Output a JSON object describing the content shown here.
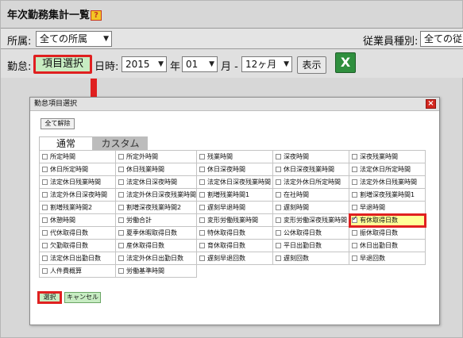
{
  "header": {
    "title": "年次勤務集計一覧",
    "help": "?"
  },
  "row1": {
    "dept_label": "所属:",
    "dept_value": "全ての所属",
    "emp_type_label": "従業員種別:",
    "emp_type_value": "全ての従"
  },
  "row2": {
    "attendance_label": "勤怠:",
    "item_select_button": "項目選択",
    "datetime_label": "日時:",
    "year_value": "2015",
    "year_unit": "年",
    "month_value": "01",
    "month_unit": "月 -",
    "period_value": "12ヶ月",
    "show_button": "表示",
    "excel_icon": "excel-export-icon"
  },
  "dialog": {
    "title": "勤怠項目選択",
    "clear_all": "全て解除",
    "tabs": [
      "通常",
      "カスタム"
    ],
    "rows": [
      [
        "所定時間",
        "所定外時間",
        "残業時間",
        "深夜時間",
        "深夜残業時間"
      ],
      [
        "休日所定時間",
        "休日残業時間",
        "休日深夜時間",
        "休日深夜残業時間",
        "法定休日所定時間"
      ],
      [
        "法定休日残業時間",
        "法定休日深夜時間",
        "法定休日深夜残業時間",
        "法定外休日所定時間",
        "法定外休日残業時間"
      ],
      [
        "法定外休日深夜時間",
        "法定外休日深夜残業時間",
        "割増残業時間1",
        "在社時間",
        "割増深夜残業時間1"
      ],
      [
        "割増残業時間2",
        "割増深夜残業時間2",
        "遅刻早退時間",
        "遅刻時間",
        "早退時間"
      ],
      [
        "休憩時間",
        "労働合計",
        "変形労働残業時間",
        "変形労働深夜残業時間",
        "有休取得日数"
      ],
      [
        "代休取得日数",
        "夏季休暇取得日数",
        "特休取得日数",
        "公休取得日数",
        "振休取得日数"
      ],
      [
        "欠勤取得日数",
        "産休取得日数",
        "育休取得日数",
        "平日出勤日数",
        "休日出勤日数"
      ],
      [
        "法定休日出勤日数",
        "法定外休日出勤日数",
        "遅刻早退回数",
        "遅刻回数",
        "早退回数"
      ],
      [
        "人件費概算",
        "労働基準時間",
        "",
        "",
        ""
      ]
    ],
    "checked_item": "有休取得日数",
    "select_button": "選択",
    "cancel_button": "キャンセル"
  },
  "colors": {
    "highlight_red": "#e02020",
    "button_green": "#c7ecc2",
    "checked_yellow": "#ffff99"
  }
}
